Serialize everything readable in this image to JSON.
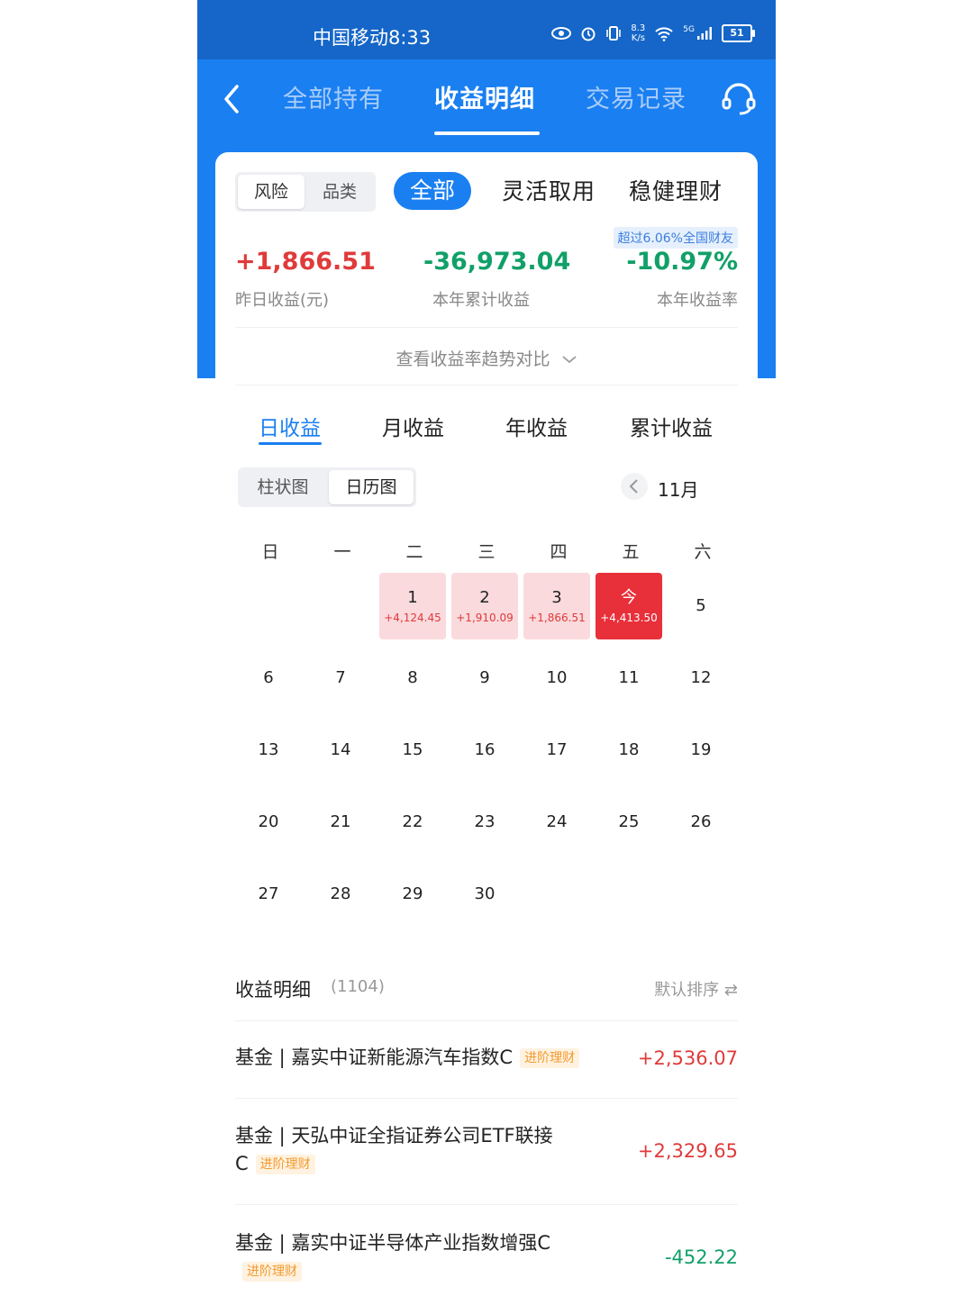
{
  "status_bar": {
    "carrier_time": "中国移动8:33",
    "net_speed_top": "8.3",
    "net_speed_bottom": "K/s",
    "net_type": "5G",
    "battery": "51"
  },
  "nav": {
    "tabs": [
      "全部持有",
      "收益明细",
      "交易记录"
    ],
    "active_tab": "收益明细"
  },
  "filter": {
    "dimension_options": [
      "风险",
      "品类"
    ],
    "selected_dimension": "风险",
    "categories": [
      "全部",
      "灵活取用",
      "稳健理财"
    ],
    "selected_category": "全部"
  },
  "summary": {
    "badge": "超过6.06%全国财友",
    "stats": [
      {
        "value": "+1,866.51",
        "label": "昨日收益(元)"
      },
      {
        "value": "-36,973.04",
        "label": "本年累计收益"
      },
      {
        "value": "-10.97%",
        "label": "本年收益率"
      }
    ],
    "trend_link": "查看收益率趋势对比"
  },
  "period_tabs": [
    "日收益",
    "月收益",
    "年收益",
    "累计收益"
  ],
  "active_period": "日收益",
  "view_modes": [
    "柱状图",
    "日历图"
  ],
  "selected_view": "日历图",
  "calendar": {
    "month": "11月",
    "weekdays": [
      "日",
      "一",
      "二",
      "三",
      "四",
      "五",
      "六"
    ],
    "days": [
      {
        "label": "1",
        "amount": "+4,124.45"
      },
      {
        "label": "2",
        "amount": "+1,910.09"
      },
      {
        "label": "3",
        "amount": "+1,866.51"
      },
      {
        "label": "今",
        "amount": "+4,413.50",
        "today": true
      },
      {
        "label": "5"
      },
      {
        "label": "6"
      },
      {
        "label": "7"
      },
      {
        "label": "8"
      },
      {
        "label": "9"
      },
      {
        "label": "10"
      },
      {
        "label": "11"
      },
      {
        "label": "12"
      },
      {
        "label": "13"
      },
      {
        "label": "14"
      },
      {
        "label": "15"
      },
      {
        "label": "16"
      },
      {
        "label": "17"
      },
      {
        "label": "18"
      },
      {
        "label": "19"
      },
      {
        "label": "20"
      },
      {
        "label": "21"
      },
      {
        "label": "22"
      },
      {
        "label": "23"
      },
      {
        "label": "24"
      },
      {
        "label": "25"
      },
      {
        "label": "26"
      },
      {
        "label": "27"
      },
      {
        "label": "28"
      },
      {
        "label": "29"
      },
      {
        "label": "30"
      }
    ]
  },
  "detail": {
    "title": "收益明细",
    "count": "(1104)",
    "sort_label": "默认排序 ⇄",
    "items": [
      {
        "name": "基金 | 嘉实中证新能源汽车指数C",
        "tag": "进阶理财",
        "amount": "+2,536.07"
      },
      {
        "name": "基金 | 天弘中证全指证券公司ETF联接C",
        "tag": "进阶理财",
        "amount": "+2,329.65"
      },
      {
        "name": "基金 | 嘉实中证半导体产业指数增强C",
        "tag": "进阶理财",
        "amount": "-452.22"
      }
    ]
  },
  "colors": {
    "brand_blue": "#1a7ff1",
    "positive_red": "#e03a3a",
    "negative_green": "#11a069",
    "today_red": "#e8303a",
    "earning_pink": "#fadadd"
  },
  "icons": {
    "back": "chevron-left-icon",
    "support": "headset-icon",
    "trend": "chevron-down-icon",
    "month_prev": "chevron-left-icon"
  }
}
